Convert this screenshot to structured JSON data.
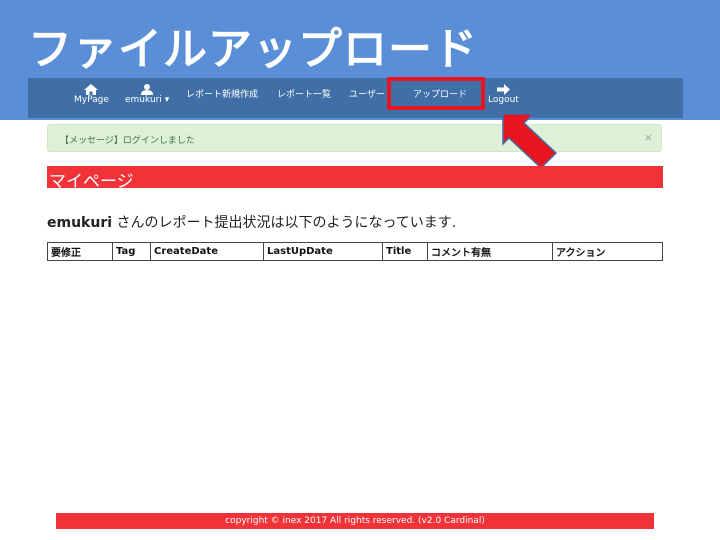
{
  "slide": {
    "title": "ファイルアップロード"
  },
  "nav": {
    "mypage": "MyPage",
    "user": "emukuri",
    "caret": "▾",
    "report_new": "レポート新規作成",
    "report_list": "レポート一覧",
    "user_menu": "ユーザー",
    "upload": "アップロード",
    "logout": "Logout"
  },
  "alert": {
    "message": "【メッセージ】ログインしました",
    "close": "×"
  },
  "page": {
    "heading": "マイページ"
  },
  "status": {
    "username": "emukuri",
    "text": " さんのレポート提出状況は以下のようになっています."
  },
  "table": {
    "headers": [
      "要修正",
      "Tag",
      "CreateDate",
      "LastUpDate",
      "Title",
      "コメント有無",
      "アクション"
    ]
  },
  "footer": {
    "text": "copyright © inex 2017 All rights reserved. (v2.0 Cardinal)"
  },
  "colors": {
    "banner": "#5a8fd8",
    "navbar": "#3f6fa6",
    "accent_red": "#ef3338",
    "highlight": "#e8141e"
  }
}
